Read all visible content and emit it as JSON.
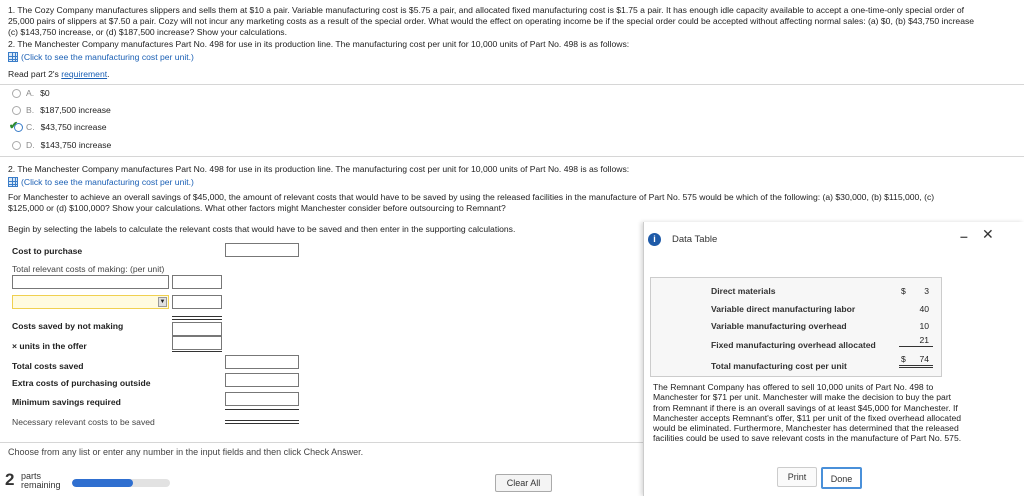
{
  "problem": {
    "p1_line1": "1. The Cozy Company manufactures slippers and sells them at $10 a pair. Variable manufacturing cost is $5.75 a pair, and allocated fixed manufacturing cost is $1.75 a pair. It has enough idle capacity available to accept a one-time-only special order of",
    "p1_line2": "25,000 pairs of slippers at $7.50 a pair. Cozy will not incur any marketing costs as a result of the special order. What would the effect on operating income be if the special order could be accepted without affecting normal sales: (a) $0, (b) $43,750 increase",
    "p1_line3": "(c) $143,750 increase, or (d) $187,500 increase? Show your calculations.",
    "p2_line1": "2. The Manchester Company manufactures Part No. 498 for use in its production line. The manufacturing cost per unit for 10,000 units of Part No. 498 is as follows:",
    "click_link": "(Click to see the manufacturing cost per unit.)",
    "read_part": "Read part 2's",
    "requirement_link": "requirement",
    "requirement_period": "."
  },
  "options": [
    {
      "letter": "A.",
      "text": "$0"
    },
    {
      "letter": "B.",
      "text": "$187,500 increase"
    },
    {
      "letter": "C.",
      "text": "$43,750 increase"
    },
    {
      "letter": "D.",
      "text": "$143,750 increase"
    }
  ],
  "part2": {
    "line1": "2. The Manchester Company manufactures Part No. 498 for use in its production line. The manufacturing cost per unit for 10,000 units of Part No. 498 is as follows:",
    "click_link": "(Click to see the manufacturing cost per unit.)",
    "q_line1": "For Manchester to achieve an overall savings of $45,000, the amount of relevant costs that would have to be saved by using the released facilities in the manufacture of Part No. 575 would be which of the following: (a) $30,000, (b) $115,000, (c)",
    "q_line2": "$125,000 or (d) $100,000? Show your calculations. What other factors might Manchester consider before outsourcing to Remnant?",
    "instruction": "Begin by selecting the labels to calculate the relevant costs that would have to be saved and then enter in the supporting calculations."
  },
  "calc_labels": {
    "cost_to_purchase": "Cost to purchase",
    "total_relevant": "Total relevant costs of making: (per unit)",
    "costs_saved": "Costs saved by not making",
    "units_offer": "× units in the offer",
    "total_saved": "Total costs saved",
    "extra_costs": "Extra costs of purchasing outside",
    "min_savings": "Minimum savings required",
    "necessary": "Necessary relevant costs to be saved"
  },
  "footer": {
    "choose": "Choose from any list or enter any number in the input fields and then click Check Answer.",
    "parts_num": "2",
    "parts_word": "parts",
    "remaining_word": "remaining",
    "progress_fraction": 0.62,
    "clear_all": "Clear All"
  },
  "data_table": {
    "title": "Data Table",
    "minimize": "–",
    "close": "✕",
    "rows": [
      {
        "label": "Direct materials",
        "dollar": "$",
        "value": "3"
      },
      {
        "label": "Variable direct manufacturing labor",
        "dollar": "",
        "value": "40"
      },
      {
        "label": "Variable manufacturing overhead",
        "dollar": "",
        "value": "10"
      },
      {
        "label": "Fixed manufacturing overhead allocated",
        "dollar": "",
        "value": "21"
      },
      {
        "label": "Total manufacturing cost per unit",
        "dollar": "$",
        "value": "74"
      }
    ],
    "desc_lines": [
      "The Remnant Company has offered to sell 10,000 units of Part No. 498 to",
      "Manchester for $71 per unit. Manchester will make the decision to buy the part",
      "from Remnant if there is an overall savings of at least $45,000 for Manchester. If",
      "Manchester accepts Remnant's offer, $11 per unit of the fixed overhead allocated",
      "would be eliminated. Furthermore, Manchester has determined that the released",
      "facilities could be used to save relevant costs in the manufacture of Part No. 575."
    ],
    "print": "Print",
    "done": "Done"
  },
  "colors": {
    "accent": "#1a5fb4",
    "progress": "#2f6fd0",
    "check": "#2e8b2e",
    "info": "#1e5aa8"
  }
}
